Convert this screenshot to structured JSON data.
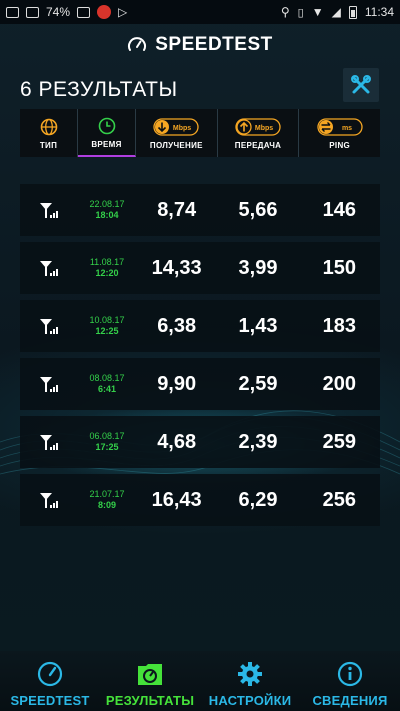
{
  "status_bar": {
    "battery": "74%",
    "time": "11:34"
  },
  "header": {
    "logo": "SPEEDTEST",
    "page_title": "6 РЕЗУЛЬТАТЫ"
  },
  "columns": {
    "type": "ТИП",
    "time": "ВРЕМЯ",
    "download": "ПОЛУЧЕНИЕ",
    "upload": "ПЕРЕДАЧА",
    "ping": "PING",
    "download_unit": "Mbps",
    "upload_unit": "Mbps",
    "ping_unit": "ms"
  },
  "results": [
    {
      "date": "22.08.17",
      "time": "18:04",
      "download": "8,74",
      "upload": "5,66",
      "ping": "146"
    },
    {
      "date": "11.08.17",
      "time": "12:20",
      "download": "14,33",
      "upload": "3,99",
      "ping": "150"
    },
    {
      "date": "10.08.17",
      "time": "12:25",
      "download": "6,38",
      "upload": "1,43",
      "ping": "183"
    },
    {
      "date": "08.08.17",
      "time": "6:41",
      "download": "9,90",
      "upload": "2,59",
      "ping": "200"
    },
    {
      "date": "06.08.17",
      "time": "17:25",
      "download": "4,68",
      "upload": "2,39",
      "ping": "259"
    },
    {
      "date": "21.07.17",
      "time": "8:09",
      "download": "16,43",
      "upload": "6,29",
      "ping": "256"
    }
  ],
  "nav": {
    "items": [
      {
        "label": "SPEEDTEST",
        "icon": "gauge-icon"
      },
      {
        "label": "РЕЗУЛЬТАТЫ",
        "icon": "folder-icon",
        "active": true
      },
      {
        "label": "НАСТРОЙКИ",
        "icon": "gear-icon"
      },
      {
        "label": "СВЕДЕНИЯ",
        "icon": "info-icon"
      }
    ]
  },
  "colors": {
    "accent_orange": "#f5a623",
    "time_green": "#34d04a",
    "nav_blue": "#2bb8e6",
    "nav_active": "#45e23a",
    "active_underline": "#b03ee0"
  }
}
